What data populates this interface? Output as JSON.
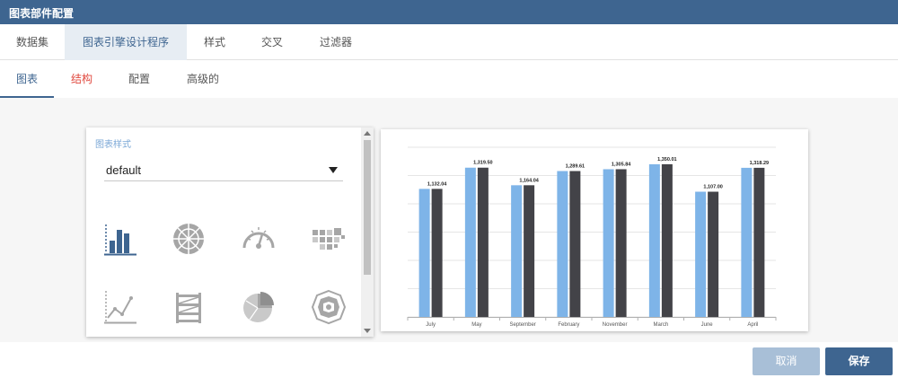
{
  "window": {
    "title": "图表部件配置"
  },
  "main_tabs": [
    {
      "label": "数据集"
    },
    {
      "label": "图表引擎设计程序"
    },
    {
      "label": "样式"
    },
    {
      "label": "交叉"
    },
    {
      "label": "过滤器"
    }
  ],
  "sub_tabs": [
    {
      "label": "图表"
    },
    {
      "label": "结构"
    },
    {
      "label": "配置"
    },
    {
      "label": "高级的"
    }
  ],
  "style_panel": {
    "label": "图表样式",
    "selected_style": "default",
    "chart_types": [
      "bar-chart-icon",
      "radar-chart-icon",
      "gauge-icon",
      "heatmap-icon",
      "line-chart-icon",
      "stacked-bar-icon",
      "pie-chart-icon",
      "rose-chart-icon"
    ]
  },
  "colors": {
    "accent": "#3e6590",
    "series_light": "#7eb4e8",
    "series_dark": "#434348",
    "link_red": "#e0483e"
  },
  "chart_data": {
    "type": "bar",
    "categories": [
      "July",
      "May",
      "September",
      "February",
      "November",
      "March",
      "June",
      "April"
    ],
    "series": [
      {
        "values": [
          1132.04,
          1319.5,
          1164.04,
          1289.61,
          1305.84,
          1350.01,
          1107.0,
          1318.29
        ]
      },
      {
        "values": [
          1132.04,
          1319.5,
          1164.04,
          1289.61,
          1305.84,
          1350.01,
          1107.0,
          1318.29
        ]
      }
    ],
    "data_labels": [
      "1,132.04",
      "1,319.50",
      "1,164.04",
      "1,289.61",
      "1,305.84",
      "1,350.01",
      "1,107.00",
      "1,318.29"
    ],
    "ylim": [
      0,
      1500
    ],
    "grid": true,
    "legend": "none"
  },
  "footer": {
    "cancel_label": "取消",
    "save_label": "保存"
  }
}
